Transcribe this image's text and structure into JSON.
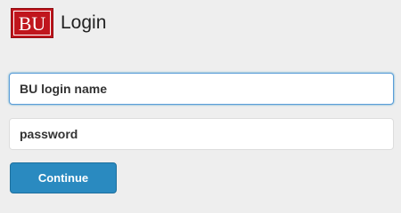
{
  "header": {
    "logo_text": "BU",
    "title": "Login"
  },
  "form": {
    "login_placeholder": "BU login name",
    "password_placeholder": "password",
    "continue_label": "Continue"
  },
  "colors": {
    "background": "#eeeeee",
    "logo_red": "#c0161d",
    "button_blue": "#2a8ac0",
    "focus_border": "#5b9dd9"
  }
}
